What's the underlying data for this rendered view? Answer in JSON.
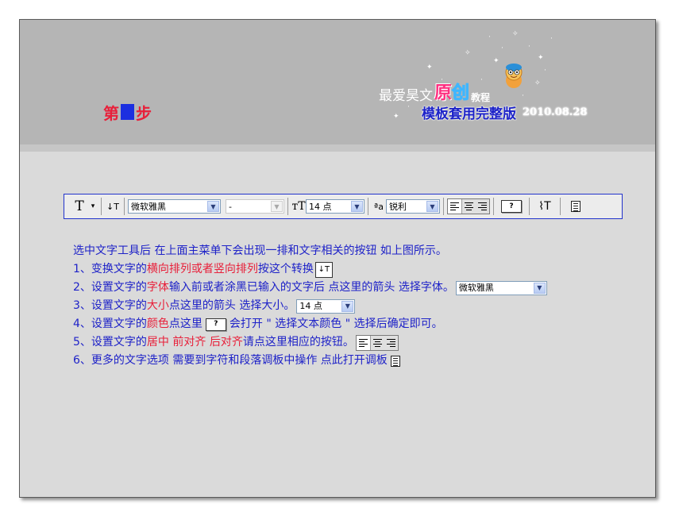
{
  "header": {
    "step_prefix": "第",
    "step_suffix": "步",
    "brand": {
      "part1": "最爱昊文",
      "highlight1": "原",
      "highlight2": "创",
      "part2": "教程",
      "subtitle": "模板套用完整版",
      "date": "2010.08.28"
    }
  },
  "toolbar": {
    "tool_icon": "T",
    "tool_menu_arrow": "▾",
    "orientation_icon": "↓T",
    "font_family": "微软雅黑",
    "font_style": "-",
    "size_icon": "тT",
    "font_size": "14 点",
    "aa_icon": "ªa",
    "anti_alias": "锐利",
    "color_button": "?",
    "warp_icon": "⌇T"
  },
  "instructions": {
    "intro": "选中文字工具后 在上面主菜单下会出现一排和文字相关的按钮 如上图所示。",
    "line1": {
      "prefix": "1、变换文字的",
      "highlight": "横向排列或者竖向排列",
      "suffix": " 按这个转换"
    },
    "line2": {
      "prefix": "2、设置文字的",
      "highlight": "字体",
      "suffix": " 输入前或者涂黑已输入的文字后 点这里的箭头 选择字体。",
      "widget_value": "微软雅黑"
    },
    "line3": {
      "prefix": "3、设置文字的",
      "highlight": "大小",
      "suffix": " 点这里的箭头 选择大小。",
      "widget_value": "14 点"
    },
    "line4": {
      "prefix": "4、设置文字的",
      "highlight": "颜色",
      "middle": " 点这里",
      "suffix": "会打开 \" 选择文本颜色 \" 选择后确定即可。",
      "widget_value": "?"
    },
    "line5": {
      "prefix": "5、设置文字的",
      "highlight": "居中 前对齐 后对齐",
      "suffix": " 请点这里相应的按钮。"
    },
    "line6": {
      "text": "6、更多的文字选项 需要到字符和段落调板中操作 点此打开调板"
    }
  },
  "colors": {
    "text_blue": "#1e22c8",
    "highlight_red": "#e8203a",
    "step_box": "#1c2fe0",
    "toolbar_border": "#2233cc"
  }
}
